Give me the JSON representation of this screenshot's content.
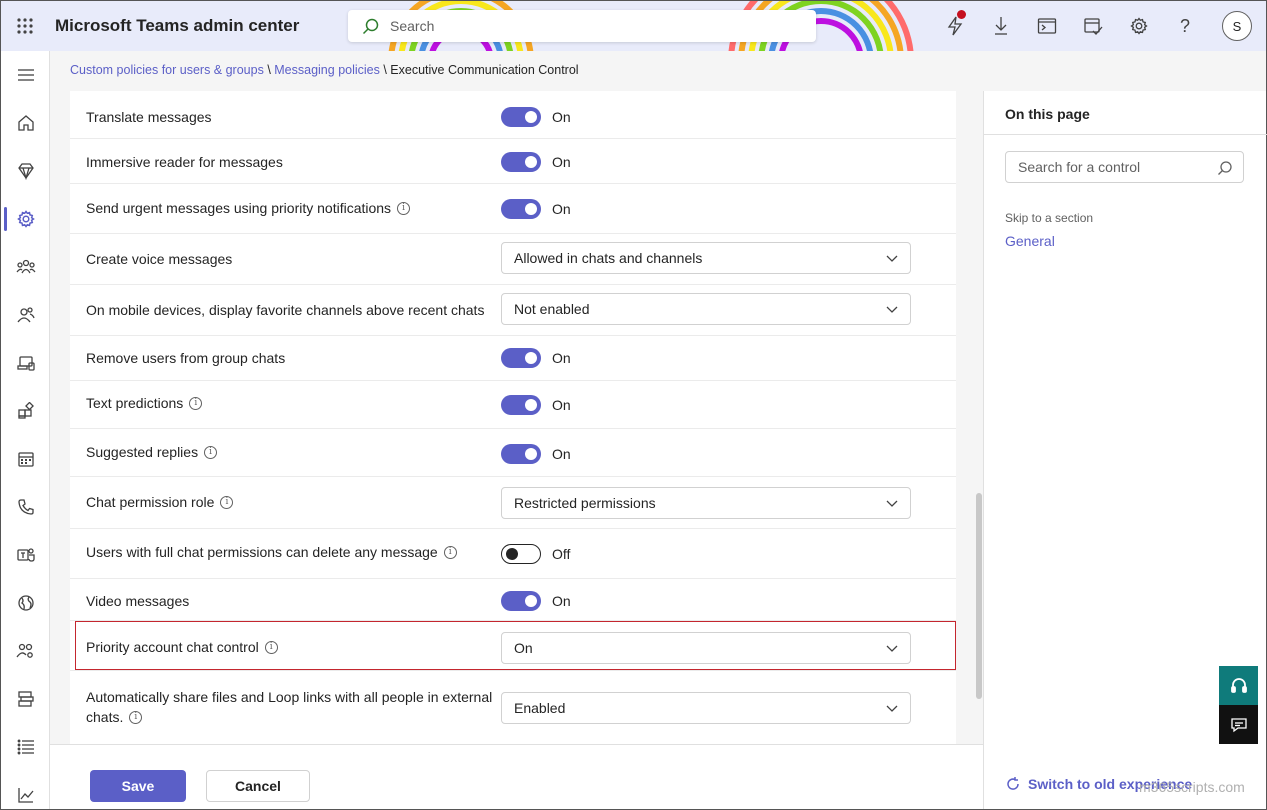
{
  "app": {
    "title": "Microsoft Teams admin center",
    "avatar_initial": "S"
  },
  "search": {
    "placeholder": "Search"
  },
  "breadcrumb": {
    "items": [
      "Custom policies for users & groups",
      "Messaging policies",
      "Executive Communication Control"
    ],
    "separator": " \\ "
  },
  "settings": [
    {
      "label": "Translate messages",
      "control": "toggle",
      "state": "On"
    },
    {
      "label": "Immersive reader for messages",
      "control": "toggle",
      "state": "On"
    },
    {
      "label": "Send urgent messages using priority notifications",
      "control": "toggle",
      "state": "On",
      "info": true
    },
    {
      "label": "Create voice messages",
      "control": "dropdown",
      "value": "Allowed in chats and channels"
    },
    {
      "label": "On mobile devices, display favorite channels above recent chats",
      "control": "dropdown",
      "value": "Not enabled"
    },
    {
      "label": "Remove users from group chats",
      "control": "toggle",
      "state": "On"
    },
    {
      "label": "Text predictions",
      "control": "toggle",
      "state": "On",
      "info": true
    },
    {
      "label": "Suggested replies",
      "control": "toggle",
      "state": "On",
      "info": true
    },
    {
      "label": "Chat permission role",
      "control": "dropdown",
      "value": "Restricted permissions",
      "info": true
    },
    {
      "label": "Users with full chat permissions can delete any message",
      "control": "toggle",
      "state": "Off",
      "info": true
    },
    {
      "label": "Video messages",
      "control": "toggle",
      "state": "On"
    },
    {
      "label": "Priority account chat control",
      "control": "dropdown",
      "value": "On",
      "info": true,
      "highlighted": true
    },
    {
      "label_line1": "Automatically share files and Loop links with all people in external",
      "label_line2": "chats.",
      "control": "dropdown",
      "value": "Enabled",
      "info": true
    }
  ],
  "right_panel": {
    "title": "On this page",
    "search_placeholder": "Search for a control",
    "skip_label": "Skip to a section",
    "sections": [
      "General"
    ],
    "switch_label": "Switch to old experience"
  },
  "footer": {
    "save_label": "Save",
    "cancel_label": "Cancel"
  },
  "watermark": "m365scripts.com",
  "colors": {
    "accent": "#5b5fc7",
    "highlight_border": "#c4262e",
    "help_button": "#0f7b7b"
  },
  "icons": {
    "nav": [
      "hamburger-icon",
      "home-icon",
      "diamond-icon",
      "gear-icon",
      "teams-icon",
      "users-icon",
      "devices-icon",
      "apps-icon",
      "calendar-icon",
      "phone-icon",
      "teams-logo-icon",
      "globe-icon",
      "people-settings-icon",
      "analytics-report-icon",
      "list-icon",
      "chart-icon"
    ]
  }
}
